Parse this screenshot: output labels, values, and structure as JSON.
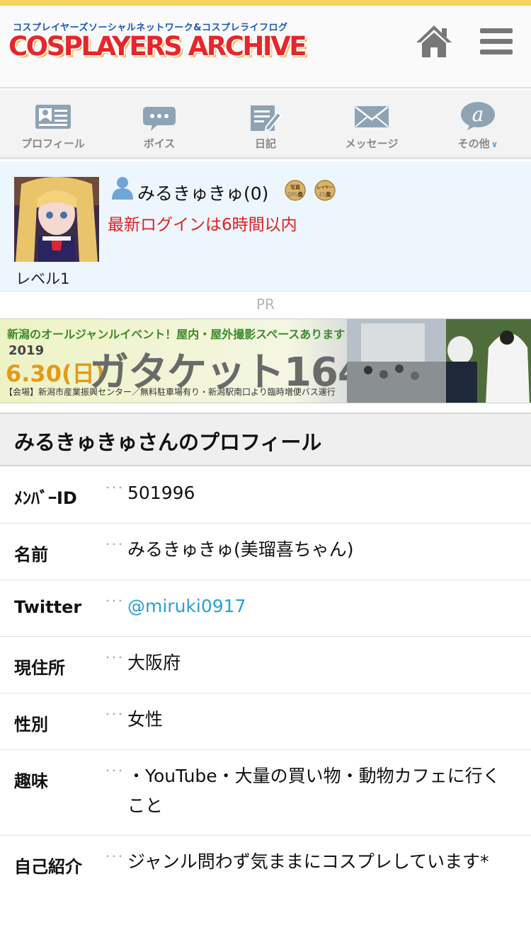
{
  "header": {
    "logo_subtitle": "コスプレイヤーズソーシャルネットワーク&コスプレライフログ",
    "logo_title": "COSPLAYERS ARCHIVE",
    "accent_color": "#f6d35a",
    "logo_color": "#e8262b",
    "icons": [
      "home-icon",
      "menu-icon"
    ]
  },
  "nav": {
    "items": [
      {
        "label": "プロフィール",
        "icon": "profile-card-icon"
      },
      {
        "label": "ボイス",
        "icon": "speech-bubble-icon"
      },
      {
        "label": "日記",
        "icon": "diary-pencil-icon"
      },
      {
        "label": "メッセージ",
        "icon": "envelope-icon"
      },
      {
        "label": "その他",
        "icon": "at-bubble-icon"
      }
    ]
  },
  "profile": {
    "username": "みるきゅきゅ(0)",
    "level": "レベル1",
    "login_status": "最新ログインは6時間以内",
    "medals": [
      {
        "top": "写真",
        "bottom": "182位"
      },
      {
        "top": "レイヤー",
        "bottom": "91位"
      }
    ]
  },
  "ad": {
    "pr_label": "PR",
    "banner_headline": "新潟のオールジャンルイベント！屋内・屋外撮影スペースあります！",
    "banner_year": "2019",
    "banner_date": "6.30(日)",
    "banner_title": "ガタケット164",
    "banner_venue": "【会場】新潟市産業振興センター／無料駐車場有り・新潟駅南口より臨時増便バス運行"
  },
  "section": {
    "title": "みるきゅきゅさんのプロフィール"
  },
  "fields": {
    "member_id": {
      "key": "ﾒﾝﾊﾞｰID",
      "value": "501996"
    },
    "name": {
      "key": "名前",
      "value": "みるきゅきゅ(美瑠喜ちゃん)"
    },
    "twitter": {
      "key": "Twitter",
      "value": "@miruki0917"
    },
    "residence": {
      "key": "現住所",
      "value": "大阪府"
    },
    "gender": {
      "key": "性別",
      "value": "女性"
    },
    "hobby": {
      "key": "趣味",
      "value": "・YouTube・大量の買い物・動物カフェに行くこと"
    },
    "intro": {
      "key": "自己紹介",
      "value": "ジャンル問わず気ままにコスプレしています*"
    },
    "separator": "･･･"
  },
  "link_color": "#2b9fd6",
  "status_color": "#e02020"
}
